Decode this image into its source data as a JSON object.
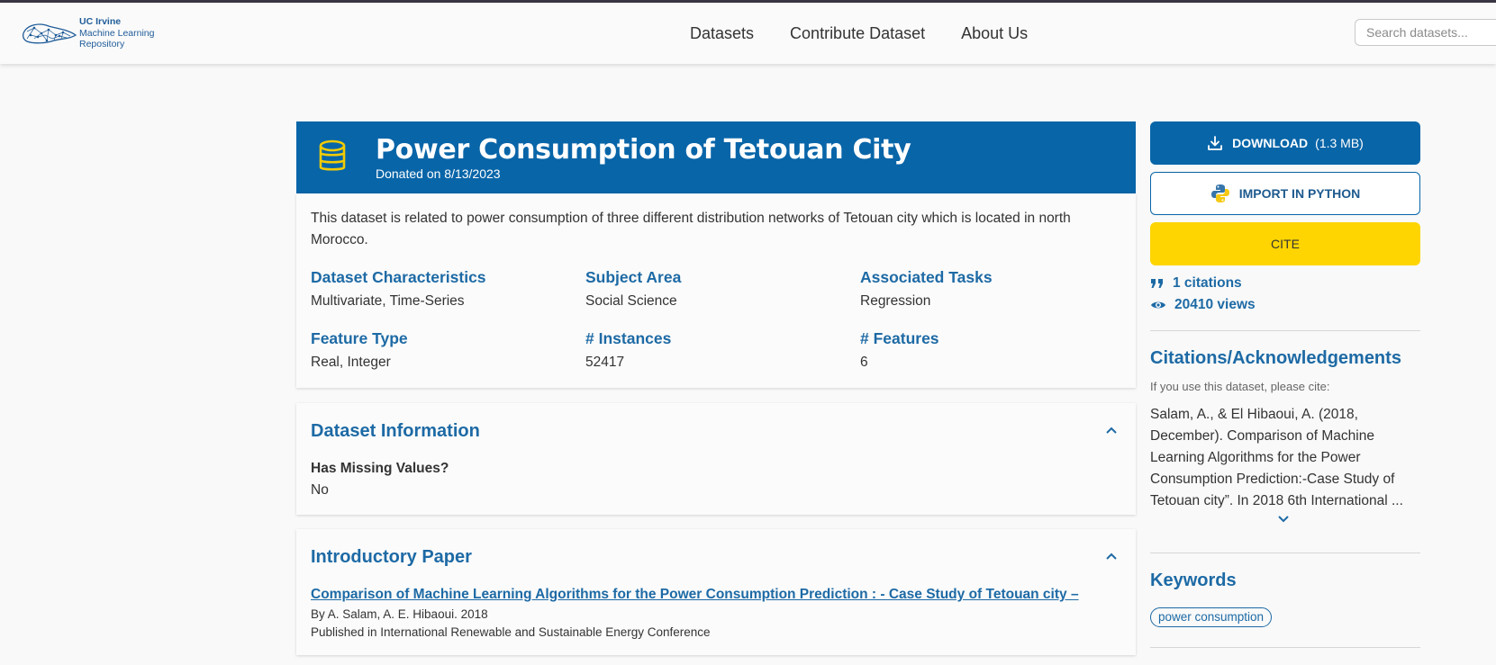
{
  "navbar": {
    "logo": {
      "line1": "UC Irvine",
      "line2": "Machine Learning",
      "line3": "Repository"
    },
    "links": [
      "Datasets",
      "Contribute Dataset",
      "About Us"
    ],
    "search_placeholder": "Search datasets..."
  },
  "dataset": {
    "title": "Power Consumption of Tetouan City",
    "donated": "Donated on 8/13/2023",
    "description": "This dataset is related to power consumption of three different distribution networks of Tetouan city which is located in north Morocco.",
    "characteristics": [
      {
        "label": "Dataset Characteristics",
        "value": "Multivariate, Time-Series"
      },
      {
        "label": "Subject Area",
        "value": "Social Science"
      },
      {
        "label": "Associated Tasks",
        "value": "Regression"
      },
      {
        "label": "Feature Type",
        "value": "Real, Integer"
      },
      {
        "label": "# Instances",
        "value": "52417"
      },
      {
        "label": "# Features",
        "value": "6"
      }
    ]
  },
  "info": {
    "title": "Dataset Information",
    "missing_label": "Has Missing Values?",
    "missing_value": "No"
  },
  "paper": {
    "title": "Introductory Paper",
    "link": "Comparison of Machine Learning Algorithms for the Power Consumption Prediction : - Case Study of Tetouan city –",
    "by": "By A. Salam, A. E. Hibaoui. 2018",
    "published": "Published in International Renewable and Sustainable Energy Conference"
  },
  "sidebar": {
    "download_label": "DOWNLOAD",
    "download_size": "(1.3 MB)",
    "import_label": "IMPORT IN PYTHON",
    "cite_label": "CITE",
    "citations": "1 citations",
    "views": "20410 views",
    "citations_title": "Citations/Acknowledgements",
    "cite_note": "If you use this dataset, please cite:",
    "cite_text": "Salam, A., & El Hibaoui, A. (2018, December). Comparison of Machine Learning Algorithms for the Power Consumption Prediction:-Case Study of Tetouan city”. In 2018 6th International ...",
    "keywords_title": "Keywords",
    "keywords": [
      "power consumption"
    ]
  },
  "colors": {
    "primary": "#0865a8",
    "accent_yellow": "#fed501",
    "heading_blue": "#1d6aa5"
  }
}
